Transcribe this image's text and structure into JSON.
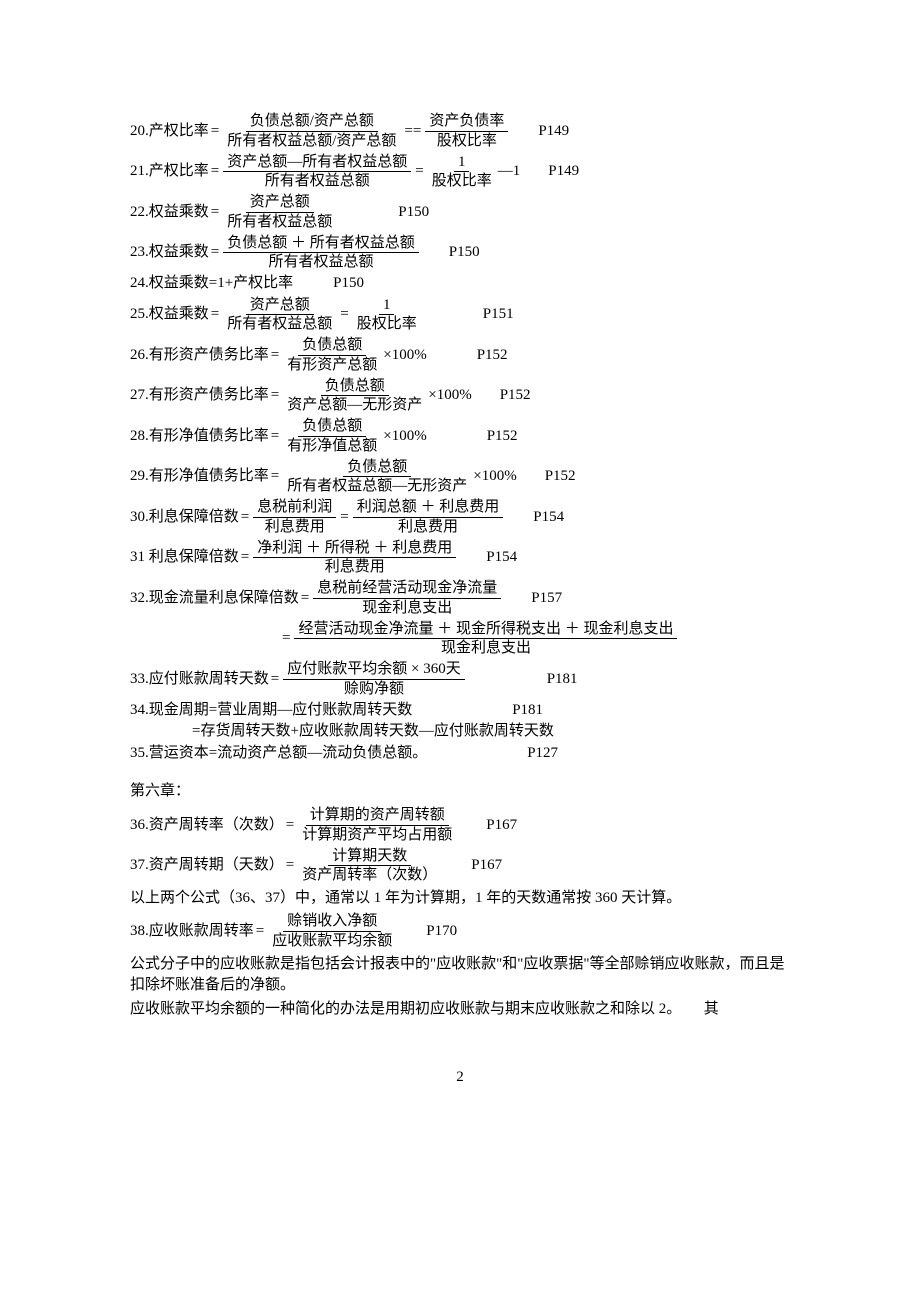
{
  "items": {
    "i20": {
      "label": "20.产权比率",
      "n1": "负债总额/资产总额",
      "d1": "所有者权益总额/资产总额",
      "n2": "资产负债率",
      "d2": "股权比率",
      "pref": "P149"
    },
    "i21": {
      "label": "21.产权比率",
      "n1": "资产总额—所有者权益总额",
      "d1": "所有者权益总额",
      "n2": "1",
      "d2": "股权比率",
      "suffix": "—1",
      "pref": "P149"
    },
    "i22": {
      "label": "22.权益乘数",
      "n1": "资产总额",
      "d1": "所有者权益总额",
      "pref": "P150"
    },
    "i23": {
      "label": "23.权益乘数",
      "n1": "负债总额 ＋ 所有者权益总额",
      "d1": "所有者权益总额",
      "pref": "P150"
    },
    "i24": {
      "text": "24.权益乘数=1+产权比率",
      "pref": "P150"
    },
    "i25": {
      "label": "25.权益乘数",
      "n1": "资产总额",
      "d1": "所有者权益总额",
      "n2": "1",
      "d2": "股权比率",
      "pref": "P151"
    },
    "i26": {
      "label": "26.有形资产债务比率",
      "n1": "负债总额",
      "d1": "有形资产总额",
      "suffix": "×100%",
      "pref": "P152"
    },
    "i27": {
      "label": "27.有形资产债务比率",
      "n1": "负债总额",
      "d1": "资产总额—无形资产",
      "suffix": "×100%",
      "pref": "P152"
    },
    "i28": {
      "label": "28.有形净值债务比率",
      "n1": "负债总额",
      "d1": "有形净值总额",
      "suffix": "×100%",
      "pref": "P152"
    },
    "i29": {
      "label": "29.有形净值债务比率",
      "n1": "负债总额",
      "d1": "所有者权益总额—无形资产",
      "suffix": "×100%",
      "pref": "P152"
    },
    "i30": {
      "label": "30.利息保障倍数",
      "n1": "息税前利润",
      "d1": "利息费用",
      "n2": "利润总额 ＋ 利息费用",
      "d2": "利息费用",
      "pref": "P154"
    },
    "i31": {
      "label": "31 利息保障倍数",
      "n1": "净利润 ＋ 所得税 ＋ 利息费用",
      "d1": "利息费用",
      "pref": "P154"
    },
    "i32": {
      "label": "32.现金流量利息保障倍数",
      "n1": "息税前经营活动现金净流量",
      "d1": "现金利息支出",
      "pref": "P157"
    },
    "i32b": {
      "n1": "经营活动现金净流量 ＋ 现金所得税支出 ＋ 现金利息支出",
      "d1": "现金利息支出"
    },
    "i33": {
      "label": "33.应付账款周转天数",
      "n1": "应付账款平均余额 × 360天",
      "d1": "赊购净额",
      "pref": "P181"
    },
    "i34": {
      "text": "34.现金周期=营业周期—应付账款周转天数",
      "pref": "P181"
    },
    "i34b": {
      "text": "=存货周转天数+应收账款周转天数—应付账款周转天数"
    },
    "i35": {
      "text": "35.营运资本=流动资产总额—流动负债总额。",
      "pref": "P127"
    },
    "chapter6": "第六章：",
    "i36": {
      "label": "36.资产周转率（次数）",
      "n1": "计算期的资产周转额",
      "d1": "计算期资产平均占用额",
      "pref": "P167"
    },
    "i37": {
      "label": "37.资产周转期（天数）",
      "n1": "计算期天数",
      "d1": "资产周转率（次数）",
      "pref": "P167"
    },
    "note3637": "以上两个公式（36、37）中，通常以 1 年为计算期，1 年的天数通常按 360 天计算。",
    "i38": {
      "label": "38.应收账款周转率",
      "n1": "赊销收入净额",
      "d1": "应收账款平均余额",
      "pref": "P170"
    },
    "note38a": "公式分子中的应收账款是指包括会计报表中的\"应收账款\"和\"应收票据\"等全部赊销应收账款，而且是扣除坏账准备后的净额。",
    "note38b": "应收账款平均余额的一种简化的办法是用期初应收账款与期末应收账款之和除以 2。　　其"
  },
  "pagenum": "2"
}
